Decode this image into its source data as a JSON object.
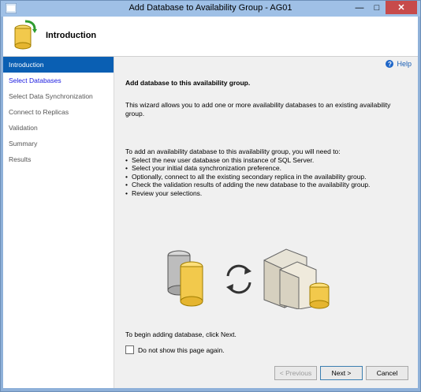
{
  "window": {
    "title": "Add Database to Availability Group - AG01"
  },
  "header": {
    "title": "Introduction"
  },
  "sidebar": {
    "items": [
      {
        "label": "Introduction"
      },
      {
        "label": "Select Databases"
      },
      {
        "label": "Select Data Synchronization"
      },
      {
        "label": "Connect to Replicas"
      },
      {
        "label": "Validation"
      },
      {
        "label": "Summary"
      },
      {
        "label": "Results"
      }
    ]
  },
  "content": {
    "help": "Help",
    "heading": "Add database to this availability group.",
    "intro": "This wizard allows you to add one or more availability databases to an existing availability group.",
    "steps_intro": "To add an availability database to this availability group, you will need to:",
    "steps": [
      "Select the new user database on this instance of SQL Server.",
      "Select your initial data synchronization preference.",
      "Optionally, connect to all the existing secondary replica in the availability group.",
      "Check the validation results of adding the new database to the availability group.",
      "Review your selections."
    ],
    "begin": "To begin adding database, click Next.",
    "checkbox_label": "Do not show this page again."
  },
  "buttons": {
    "previous": "< Previous",
    "next": "Next >",
    "cancel": "Cancel"
  }
}
